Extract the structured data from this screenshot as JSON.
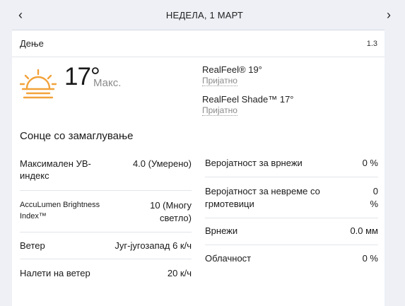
{
  "nav": {
    "prev": "‹",
    "next": "›",
    "title": "НЕДЕЛА, 1 МАРТ"
  },
  "section": {
    "title": "Дење",
    "version": "1.3"
  },
  "current": {
    "icon": "hazy-sun-icon",
    "temperature": "17°",
    "max_label": "Макс.",
    "realfeel_label": "RealFeel® 19°",
    "realfeel_desc": "Пријатно",
    "realfeel_shade_label": "RealFeel Shade™ 17°",
    "realfeel_shade_desc": "Пријатно",
    "phrase": "Сонце со замаглување"
  },
  "left_details": [
    {
      "label": "Максимален УВ-индекс",
      "value": "4.0 (Умерено)"
    },
    {
      "label": "AccuLumen Brightness Index™",
      "value": "10 (Многу светло)"
    },
    {
      "label": "Ветер",
      "value": "Југ-југозапад 6 к/ч"
    },
    {
      "label": "Налети на ветер",
      "value": "20 к/ч"
    }
  ],
  "right_details": [
    {
      "label": "Веројатност за врнежи",
      "value": "0 %"
    },
    {
      "label": "Веројатност за невреме со грмотевици",
      "value": "0 %"
    },
    {
      "label": "Врнежи",
      "value": "0.0 мм"
    },
    {
      "label": "Облачност",
      "value": "0 %"
    }
  ],
  "colors": {
    "page_bg": "#eef0f6",
    "icon_orange": "#f2a23a"
  }
}
